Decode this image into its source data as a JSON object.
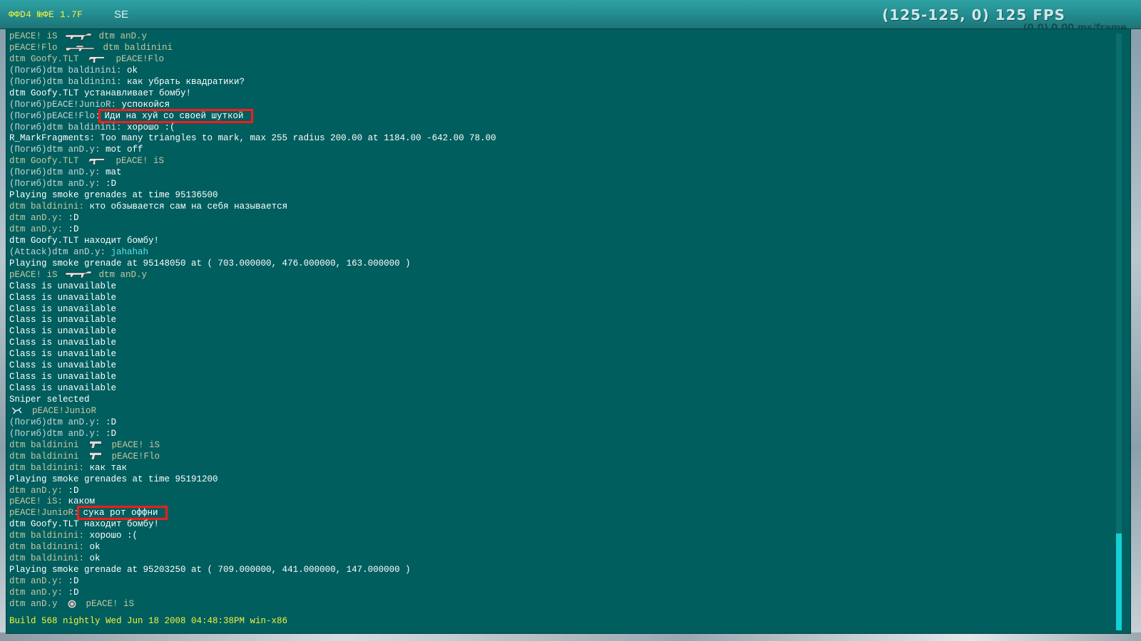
{
  "topbar": {
    "version": "ФФD4 №ФE 1.7F",
    "heading": "SE",
    "fps": "(125-125, 0) 125 FPS",
    "fps_sub": "(0.0) 0.00 ms/frame"
  },
  "colors": {
    "console_bg": "#005e5e",
    "highlight_box": "#ff1a1a",
    "build_text": "#f2f23a",
    "team_text": "#c8c8a0",
    "cyan_text": "#5fe3ea"
  },
  "console": {
    "lines": [
      {
        "a": "pEACE! iS",
        "weapon": "rifle-icon",
        "b": "dtm anD.y"
      },
      {
        "a": "pEACE!Flo",
        "weapon": "sniper-icon",
        "b": "dtm baldinini"
      },
      {
        "a": "dtm Goofy.TLT",
        "weapon": "smg-icon",
        "b": "pEACE!Flo"
      },
      {
        "dead": "(Погиб)dtm baldinini: ",
        "text": "ok"
      },
      {
        "dead": "(Погиб)dtm baldinini: ",
        "text": "как убрать квадратики?"
      },
      {
        "text": "dtm Goofy.TLT устанавливает бомбу!"
      },
      {
        "dead": "(Погиб)pEACE!JunioR: ",
        "text": "успокойся"
      },
      {
        "dead": "(Погиб)pEACE!Flo:",
        "text": "Иди на хуй со своей шуткой",
        "highlight": true
      },
      {
        "dead": "(Погиб)dtm baldinini: ",
        "text": "хорошо :("
      },
      {
        "text": "R_MarkFragments: Too many triangles to mark, max 255 radius 200.00 at 1184.00 -642.00 78.00"
      },
      {
        "dead": "(Погиб)dtm anD.y: ",
        "text": "mot off"
      },
      {
        "a": "dtm Goofy.TLT",
        "weapon": "smg-icon",
        "b": "pEACE! iS"
      },
      {
        "dead": "(Погиб)dtm anD.y: ",
        "text": "mat"
      },
      {
        "dead": "(Погиб)dtm anD.y: ",
        "text": ":D"
      },
      {
        "text": "Playing smoke grenades at time 95136500"
      },
      {
        "team": "dtm baldinini: ",
        "text": "кто обзывается сам на себя называется"
      },
      {
        "team": "dtm anD.y: ",
        "text": ":D"
      },
      {
        "team": "dtm anD.y: ",
        "text": ":D"
      },
      {
        "text": "dtm Goofy.TLT находит бомбу!"
      },
      {
        "dead": "(Attack)dtm anD.y: ",
        "cyan": "jahahah"
      },
      {
        "text": "Playing smoke grenade at 95148050 at ( 703.000000, 476.000000, 163.000000 )"
      },
      {
        "a": "pEACE! iS",
        "weapon": "rifle-icon",
        "b": "dtm anD.y"
      },
      {
        "text": "Class is unavailable"
      },
      {
        "text": "Class is unavailable"
      },
      {
        "text": "Class is unavailable"
      },
      {
        "text": "Class is unavailable"
      },
      {
        "text": "Class is unavailable"
      },
      {
        "text": "Class is unavailable"
      },
      {
        "text": "Class is unavailable"
      },
      {
        "text": "Class is unavailable"
      },
      {
        "text": "Class is unavailable"
      },
      {
        "text": "Class is unavailable"
      },
      {
        "text": "Sniper selected"
      },
      {
        "weapon_first": "fall-icon",
        "b": "pEACE!JunioR"
      },
      {
        "dead": "(Погиб)dtm anD.y: ",
        "text": ":D"
      },
      {
        "dead": "(Погиб)dtm anD.y: ",
        "text": ":D"
      },
      {
        "a": "dtm baldinini",
        "weapon": "pistol-icon",
        "b": "pEACE! iS"
      },
      {
        "a": "dtm baldinini",
        "weapon": "pistol-icon",
        "b": "pEACE!Flo"
      },
      {
        "team": "dtm baldinini: ",
        "text": "как так"
      },
      {
        "text": "Playing smoke grenades at time 95191200"
      },
      {
        "team": "dtm anD.y: ",
        "text": ":D"
      },
      {
        "team": "pEACE! iS: ",
        "text": "каком"
      },
      {
        "team": "pEACE!JunioR:",
        "text": "сука рот оффни",
        "highlight": true
      },
      {
        "text": "dtm Goofy.TLT находит бомбу!"
      },
      {
        "team": "dtm baldinini: ",
        "text": "хорошо :("
      },
      {
        "team": "dtm baldinini: ",
        "text": "ok"
      },
      {
        "team": "dtm baldinini: ",
        "text": "ok"
      },
      {
        "text": "Playing smoke grenade at 95203250 at ( 709.000000, 441.000000, 147.000000 )"
      },
      {
        "team": "dtm anD.y: ",
        "text": ":D"
      },
      {
        "team": "dtm anD.y: ",
        "text": ":D"
      },
      {
        "a": "dtm anD.y",
        "weapon": "grenade-icon",
        "b": "pEACE! iS"
      }
    ],
    "build": "Build 568 nightly Wed Jun 18 2008 04:48:38PM win-x86",
    "scroll_fraction": 0.84
  }
}
